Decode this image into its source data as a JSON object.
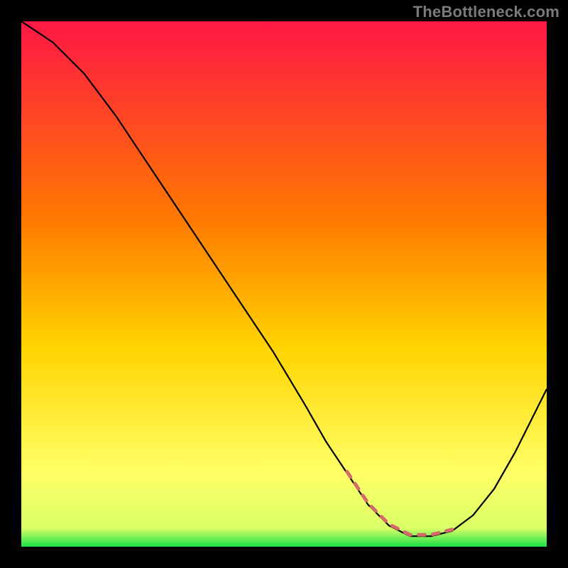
{
  "watermark": "TheBottleneck.com",
  "colors": {
    "bg": "#000000",
    "curve": "#000000",
    "highlight": "#d46a6a",
    "grad_top": "#ff1744",
    "grad_mid": "#ffd400",
    "grad_low": "#ffff66",
    "grad_bottom": "#19e24a"
  },
  "chart_data": {
    "type": "line",
    "title": "",
    "xlabel": "",
    "ylabel": "",
    "xlim": [
      0,
      100
    ],
    "ylim": [
      0,
      100
    ],
    "legend": false,
    "grid": false,
    "series": [
      {
        "name": "bottleneck-curve",
        "x": [
          0,
          6,
          12,
          18,
          24,
          30,
          36,
          42,
          48,
          54,
          58,
          62,
          66,
          70,
          74,
          78,
          82,
          86,
          90,
          94,
          98,
          100
        ],
        "y": [
          100,
          96,
          90,
          82,
          73,
          64,
          55,
          46,
          37,
          27,
          20,
          14,
          8,
          4,
          2,
          2,
          3,
          6,
          11,
          18,
          26,
          30
        ]
      }
    ],
    "highlight_segment": {
      "series": "bottleneck-curve",
      "x_start": 62,
      "x_end": 82,
      "note": "red dashed plateau segment near the bottom"
    },
    "background_gradient": {
      "stops": [
        {
          "offset": 0.0,
          "color": "#ff1744"
        },
        {
          "offset": 0.38,
          "color": "#ff7a00"
        },
        {
          "offset": 0.62,
          "color": "#ffd400"
        },
        {
          "offset": 0.86,
          "color": "#ffff66"
        },
        {
          "offset": 0.965,
          "color": "#d9ff66"
        },
        {
          "offset": 1.0,
          "color": "#19e24a"
        }
      ]
    }
  }
}
